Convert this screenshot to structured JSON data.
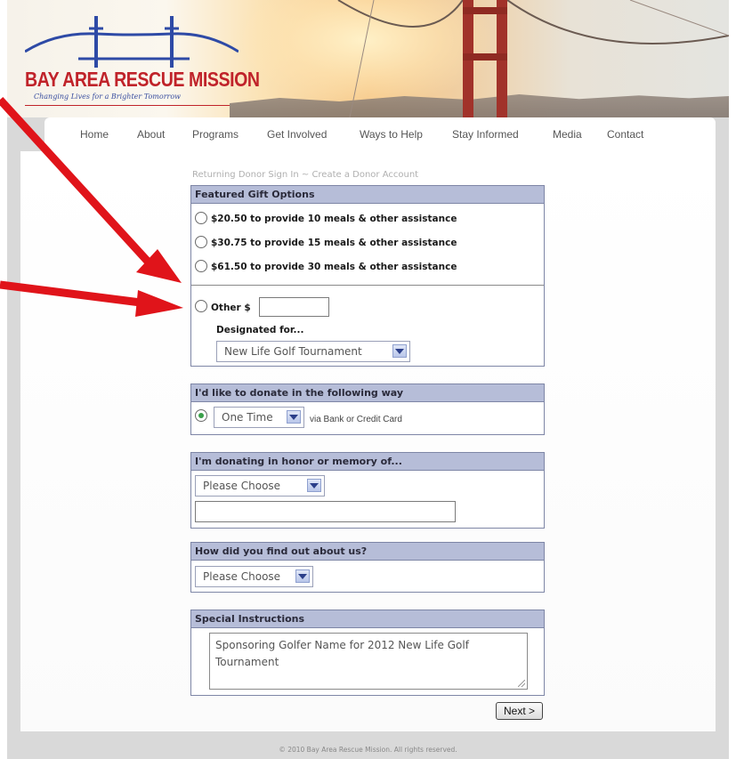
{
  "header": {
    "logo_name": "BAY AREA RESCUE MISSION",
    "logo_tagline": "Changing Lives for a Brighter Tomorrow"
  },
  "nav": {
    "items": [
      {
        "label": "Home"
      },
      {
        "label": "About"
      },
      {
        "label": "Programs"
      },
      {
        "label": "Get Involved"
      },
      {
        "label": "Ways to Help"
      },
      {
        "label": "Stay Informed"
      },
      {
        "label": "Media"
      },
      {
        "label": "Contact"
      }
    ]
  },
  "crumbs": {
    "sign_in": "Returning Donor Sign In",
    "separator": "~",
    "create": "Create a Donor Account"
  },
  "gift": {
    "title": "Featured Gift Options",
    "options": [
      {
        "label": "$20.50 to provide 10 meals & other assistance"
      },
      {
        "label": "$30.75 to provide 15 meals & other assistance"
      },
      {
        "label": "$61.50 to provide 30 meals & other assistance"
      }
    ],
    "other_label": "Other $",
    "other_value": "",
    "designated_label": "Designated for...",
    "designated_value": "New Life Golf Tournament"
  },
  "donate_way": {
    "title": "I'd like to donate in the following way",
    "frequency": "One Time",
    "via_text": "via Bank or Credit Card"
  },
  "honor": {
    "title": "I'm donating in honor or memory of...",
    "select_value": "Please Choose",
    "name_value": ""
  },
  "found": {
    "title": "How did you find out about us?",
    "select_value": "Please Choose"
  },
  "special": {
    "title": "Special Instructions",
    "text": "Sponsoring Golfer Name for 2012 New Life Golf Tournament"
  },
  "next_label": "Next >",
  "footer_text": "© 2010 Bay Area Rescue Mission. All rights reserved.",
  "colors": {
    "arrow": "#e0141a",
    "section_header": "#b6bdd8",
    "brand_red": "#c0232a",
    "brand_blue": "#2e4aa6"
  }
}
